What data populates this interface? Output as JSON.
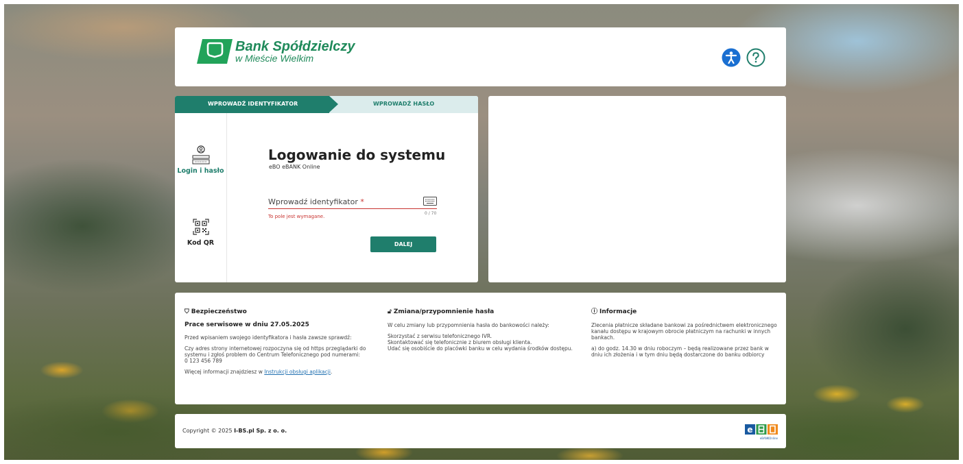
{
  "header": {
    "bank_name": "Bank Spółdzielczy",
    "bank_sub": "w Mieście Wielkim",
    "icons": [
      "accessibility-icon",
      "help-icon"
    ]
  },
  "steps": {
    "step1": "WPROWADŹ IDENTYFIKATOR",
    "step2": "WPROWADŹ HASŁO"
  },
  "side_menu": {
    "login_label": "Login i hasło",
    "qr_label": "Kod QR"
  },
  "login": {
    "title": "Logowanie do systemu",
    "subtitle": "eBO eBANK Online",
    "field_label": "Wprowadź identyfikator",
    "required_mark": "*",
    "counter": "0 / 70",
    "error": "To pole jest wymagane.",
    "button": "DALEJ"
  },
  "info": {
    "security": {
      "title": "Bezpieczeństwo",
      "notice": "Prace serwisowe w dniu 27.05.2025",
      "p1": "Przed wpisaniem swojego identyfikatora i hasła zawsze sprawdź:",
      "p2": "Czy adres strony internetowej rozpoczyna się od https przeglądarki do systemu i zgłoś problem do Centrum Telefonicznego pod numerami:",
      "phone": "0 123 456 789",
      "more_prefix": "Więcej informacji znajdziesz w ",
      "more_link": "Instrukcji obsługi aplikacji",
      "more_suffix": "."
    },
    "password": {
      "title": "Zmiana/przypomnienie hasła",
      "p1": "W celu zmiany lub przypomnienia hasła do bankowości należy:",
      "l1": "Skorzystać z serwisu telefonicznego IVR.",
      "l2": "Skontaktować się telefonicznie z biurem obsługi klienta.",
      "l3": "Udać się osobiście do placówki banku w celu wydania środków dostępu."
    },
    "information": {
      "title": "Informacje",
      "p1": "Zlecenia płatnicze składane bankowi za pośrednictwem elektronicznego kanału dostępu w krajowym obrocie płatniczym na rachunki w innych bankach.",
      "p2": "a) do godz. 14.30 w dniu roboczym – będą realizowane przez bank w dniu ich złożenia i w tym dniu będą dostarczone do banku odbiorcy"
    }
  },
  "footer": {
    "copyright_prefix": "Copyright © 2025 ",
    "company": "I-BS.pl Sp. z o. o.",
    "ebo_caption": "eBANKOnline"
  },
  "colors": {
    "primary": "#1f7e6c",
    "brand_green": "#1f8a5a",
    "accessibility_blue": "#1a6fd1",
    "error": "#c8322f",
    "step_bg": "#dbecec"
  }
}
